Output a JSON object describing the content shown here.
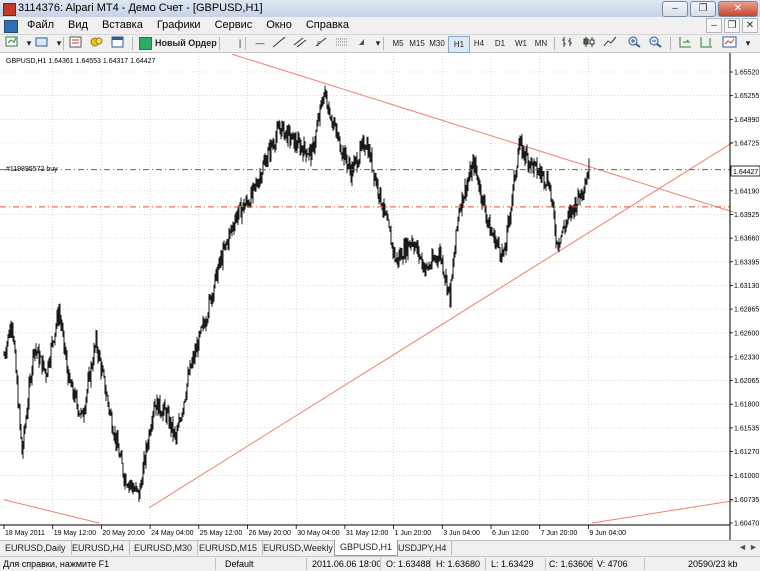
{
  "window": {
    "title": "3114376: Alpari MT4 - Демо Счет - [GBPUSD,H1]",
    "buttons": [
      "–",
      "❐",
      "✕"
    ]
  },
  "menu": {
    "items": [
      "Файл",
      "Вид",
      "Вставка",
      "Графики",
      "Сервис",
      "Окно",
      "Справка"
    ],
    "mdi_buttons": [
      "–",
      "❐",
      "✕"
    ]
  },
  "toolbar": {
    "new_order_label": "Новый Ордер",
    "timeframes": [
      "M5",
      "M15",
      "M30",
      "H1",
      "H4",
      "D1",
      "W1",
      "MN"
    ],
    "active_timeframe": "H1"
  },
  "chart": {
    "header": "GBPUSD,H1  1.64361 1.64553 1.64317 1.64427",
    "order_label": "#119895572 buy",
    "current_price_label": "1.64427",
    "price_ticks": [
      "1.65520",
      "1.65255",
      "1.64990",
      "1.64725",
      "1.64190",
      "1.63925",
      "1.63660",
      "1.63395",
      "1.63130",
      "1.62865",
      "1.62600",
      "1.62330",
      "1.62065",
      "1.61800",
      "1.61535",
      "1.61270",
      "1.61000",
      "1.60735",
      "1.60470"
    ],
    "time_ticks": [
      "18 May 2011",
      "19 May 12:00",
      "20 May 20:00",
      "24 May 04:00",
      "25 May 12:00",
      "26 May 20:00",
      "30 May 04:00",
      "31 May 12:00",
      "1 Jun 20:00",
      "3 Jun 04:00",
      "6 Jun 12:00",
      "7 Jun 20:00",
      "9 Jun 04:00"
    ],
    "colors": {
      "candles": "#000000",
      "trendlines": "#f08070",
      "order_line": "#2e8b2e",
      "stop_line": "#e25533",
      "grid": "#c0c0c0"
    }
  },
  "chart_data": {
    "type": "candlestick",
    "symbol": "GBPUSD",
    "timeframe": "H1",
    "ylim": [
      1.6047,
      1.6565
    ],
    "last": {
      "open": 1.64361,
      "high": 1.64553,
      "low": 1.64317,
      "close": 1.64427
    },
    "order_price": 1.64427,
    "stop_price": 1.6401,
    "close_path": [
      {
        "bar": 0,
        "price": 1.6235
      },
      {
        "bar": 8,
        "price": 1.6275
      },
      {
        "bar": 18,
        "price": 1.6125
      },
      {
        "bar": 30,
        "price": 1.6245
      },
      {
        "bar": 42,
        "price": 1.6215
      },
      {
        "bar": 55,
        "price": 1.6285
      },
      {
        "bar": 65,
        "price": 1.6205
      },
      {
        "bar": 78,
        "price": 1.6165
      },
      {
        "bar": 92,
        "price": 1.625
      },
      {
        "bar": 106,
        "price": 1.617
      },
      {
        "bar": 120,
        "price": 1.61
      },
      {
        "bar": 135,
        "price": 1.6078
      },
      {
        "bar": 150,
        "price": 1.6182
      },
      {
        "bar": 162,
        "price": 1.617
      },
      {
        "bar": 172,
        "price": 1.614
      },
      {
        "bar": 185,
        "price": 1.6214
      },
      {
        "bar": 200,
        "price": 1.627
      },
      {
        "bar": 215,
        "price": 1.6335
      },
      {
        "bar": 232,
        "price": 1.6391
      },
      {
        "bar": 248,
        "price": 1.6413
      },
      {
        "bar": 262,
        "price": 1.6455
      },
      {
        "bar": 276,
        "price": 1.649
      },
      {
        "bar": 292,
        "price": 1.6472
      },
      {
        "bar": 308,
        "price": 1.646
      },
      {
        "bar": 320,
        "price": 1.653
      },
      {
        "bar": 333,
        "price": 1.648
      },
      {
        "bar": 347,
        "price": 1.644
      },
      {
        "bar": 362,
        "price": 1.6475
      },
      {
        "bar": 378,
        "price": 1.6405
      },
      {
        "bar": 392,
        "price": 1.634
      },
      {
        "bar": 408,
        "price": 1.6365
      },
      {
        "bar": 422,
        "price": 1.633
      },
      {
        "bar": 436,
        "price": 1.635
      },
      {
        "bar": 446,
        "price": 1.63
      },
      {
        "bar": 455,
        "price": 1.64
      },
      {
        "bar": 470,
        "price": 1.645
      },
      {
        "bar": 486,
        "price": 1.6375
      },
      {
        "bar": 500,
        "price": 1.6345
      },
      {
        "bar": 515,
        "price": 1.647
      },
      {
        "bar": 530,
        "price": 1.6445
      },
      {
        "bar": 545,
        "price": 1.643
      },
      {
        "bar": 553,
        "price": 1.636
      },
      {
        "bar": 565,
        "price": 1.639
      },
      {
        "bar": 578,
        "price": 1.642
      },
      {
        "bar": 585,
        "price": 1.6443
      }
    ],
    "trendlines": [
      {
        "from": {
          "bar": 228,
          "price": 1.6572
        },
        "to": {
          "bar": 730,
          "price": 1.6395
        }
      },
      {
        "from": {
          "bar": 145,
          "price": 1.6064
        },
        "to": {
          "bar": 730,
          "price": 1.6474
        }
      },
      {
        "from": {
          "bar": 0,
          "price": 1.6073
        },
        "to": {
          "bar": 95,
          "price": 1.6047
        }
      },
      {
        "from": {
          "bar": 588,
          "price": 1.6047
        },
        "to": {
          "bar": 730,
          "price": 1.6072
        }
      }
    ]
  },
  "tabs": {
    "items": [
      "EURUSD,Daily",
      "EURUSD,H4",
      "EURUSD,M30",
      "EURUSD,M15",
      "EURUSD,Weekly",
      "GBPUSD,H1",
      "USDJPY,H4"
    ],
    "active": "GBPUSD,H1",
    "nav": [
      "◄",
      "►"
    ]
  },
  "status": {
    "help": "Для справки, нажмите F1",
    "profile": "Default",
    "time": "2011.06.06 18:00",
    "open": "O: 1.63488",
    "high": "H: 1.63680",
    "low": "L: 1.63429",
    "close": "C: 1.63606",
    "volume": "V: 4706",
    "traffic": "20590/23 kb"
  }
}
